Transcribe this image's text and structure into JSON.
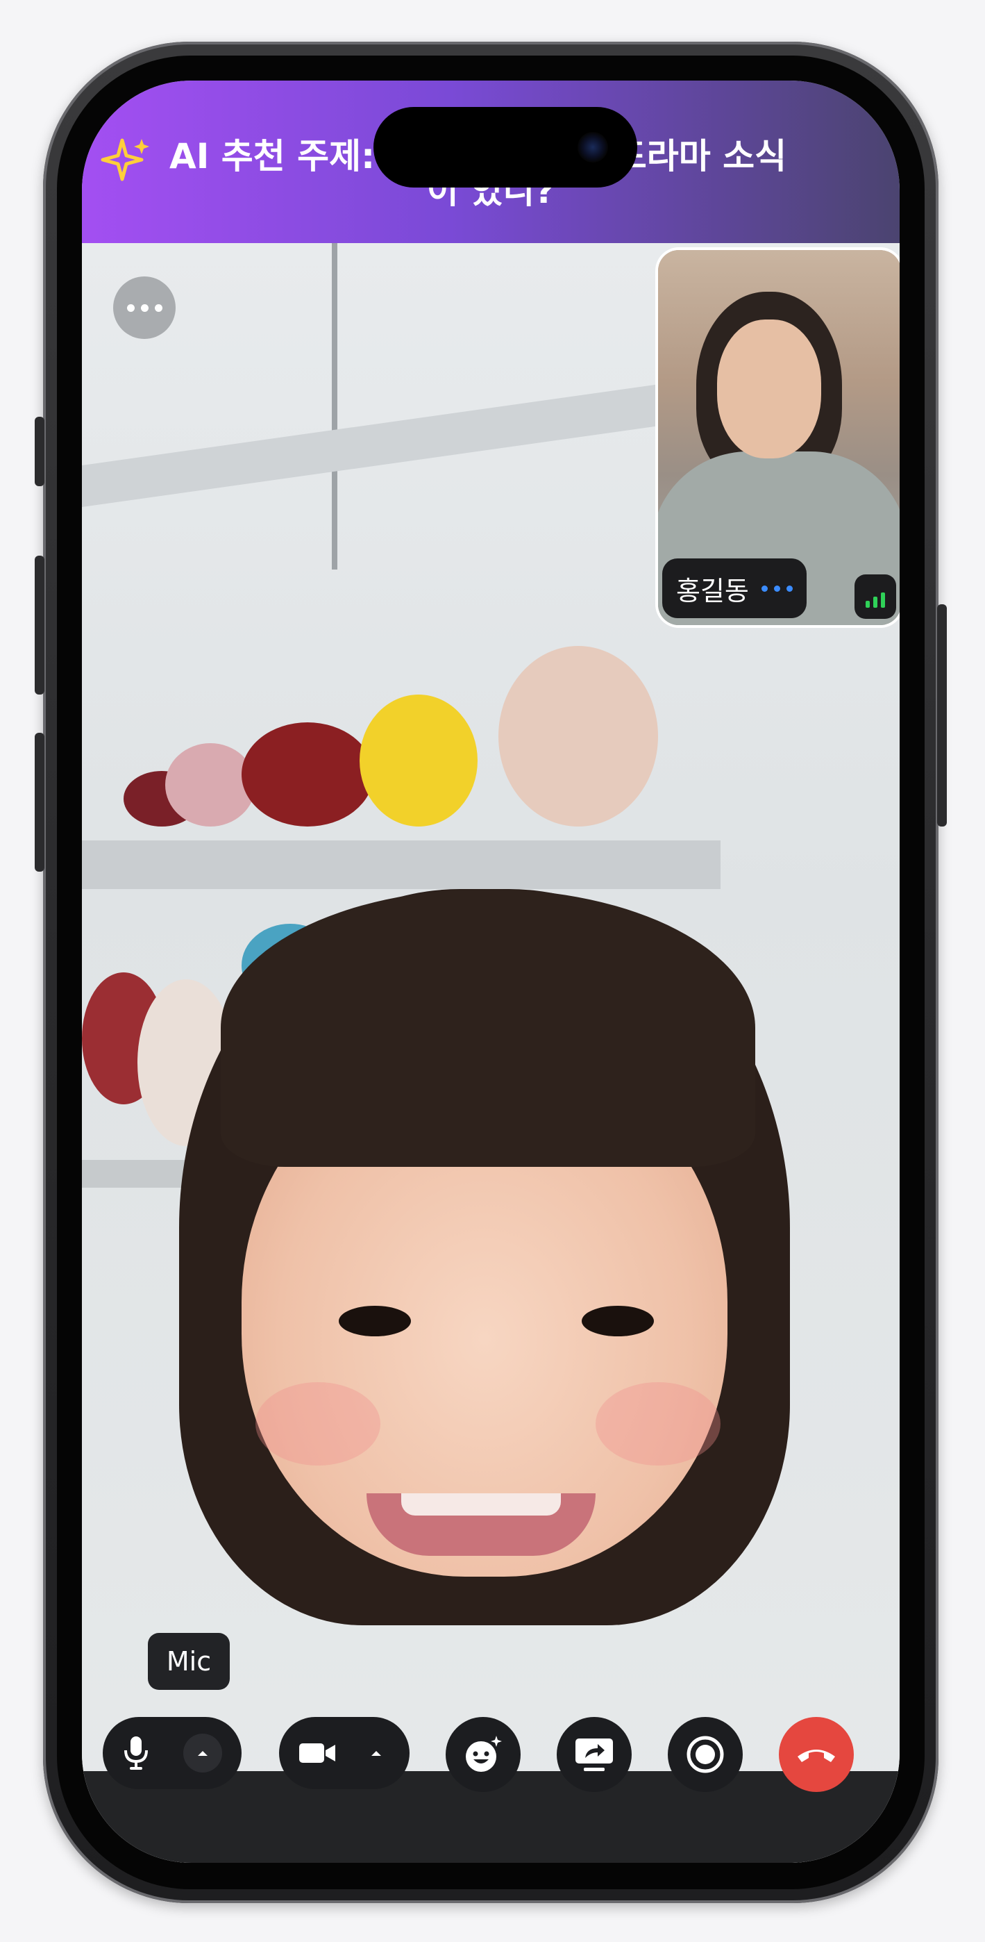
{
  "banner": {
    "icon": "sparkle-icon",
    "text_line1": "AI 추천 주제: 요즘 본 영화나 드라마 소식",
    "text_line2": "이 있니?",
    "gradient_colors": [
      "#a34ff2",
      "#4b4470"
    ]
  },
  "pip": {
    "participant_name": "홍길동",
    "status_icon": "speaking-dots-icon",
    "signal_icon": "signal-strength-icon"
  },
  "controls": {
    "mic_tooltip": "Mic",
    "end_call_color": "#e5473f",
    "buttons": [
      "microphone",
      "microphone-options",
      "camera",
      "camera-options",
      "effects",
      "share-screen",
      "record",
      "end-call"
    ]
  }
}
